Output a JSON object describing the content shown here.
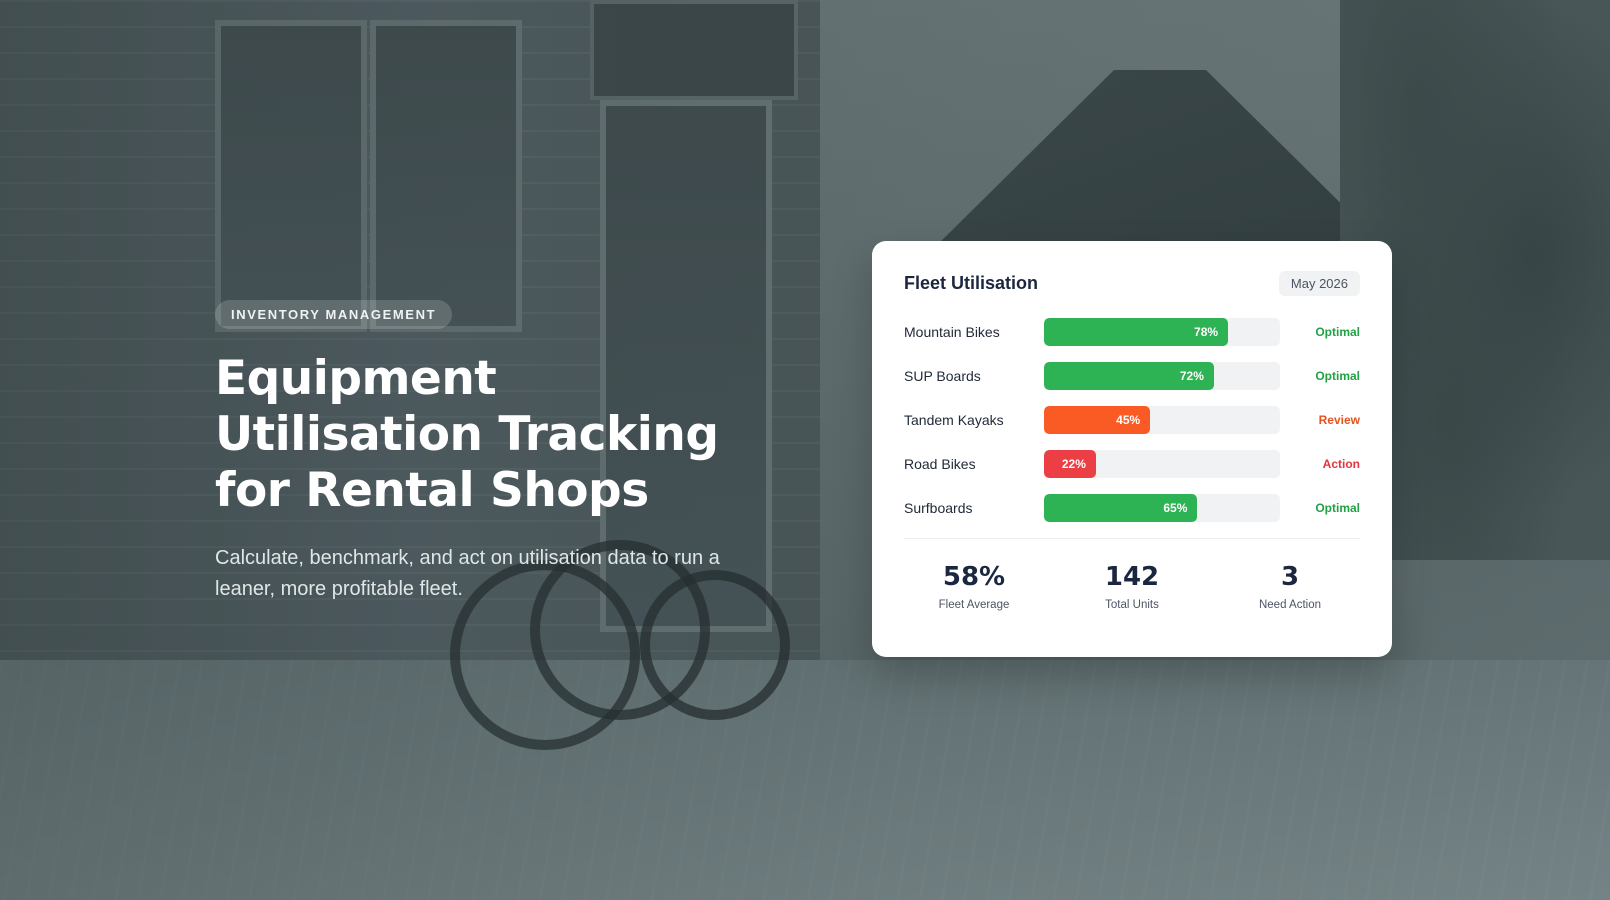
{
  "hero": {
    "eyebrow": "INVENTORY MANAGEMENT",
    "title": "Equipment Utilisation Tracking for Rental Shops",
    "subtitle": "Calculate, benchmark, and act on utilisation data to run a leaner, more profitable fleet."
  },
  "card": {
    "title": "Fleet Utilisation",
    "period": "May 2026",
    "rows": [
      {
        "label": "Mountain Bikes",
        "percent": 78,
        "percent_label": "78%",
        "status": "Optimal",
        "color": "#2db353",
        "status_color": "#22a045"
      },
      {
        "label": "SUP Boards",
        "percent": 72,
        "percent_label": "72%",
        "status": "Optimal",
        "color": "#2db353",
        "status_color": "#22a045"
      },
      {
        "label": "Tandem Kayaks",
        "percent": 45,
        "percent_label": "45%",
        "status": "Review",
        "color": "#fa5b24",
        "status_color": "#e5531c"
      },
      {
        "label": "Road Bikes",
        "percent": 22,
        "percent_label": "22%",
        "status": "Action",
        "color": "#ec3e45",
        "status_color": "#e0353c"
      },
      {
        "label": "Surfboards",
        "percent": 65,
        "percent_label": "65%",
        "status": "Optimal",
        "color": "#2db353",
        "status_color": "#22a045"
      }
    ],
    "stats": [
      {
        "value": "58%",
        "label": "Fleet Average"
      },
      {
        "value": "142",
        "label": "Total Units"
      },
      {
        "value": "3",
        "label": "Need Action"
      }
    ]
  }
}
